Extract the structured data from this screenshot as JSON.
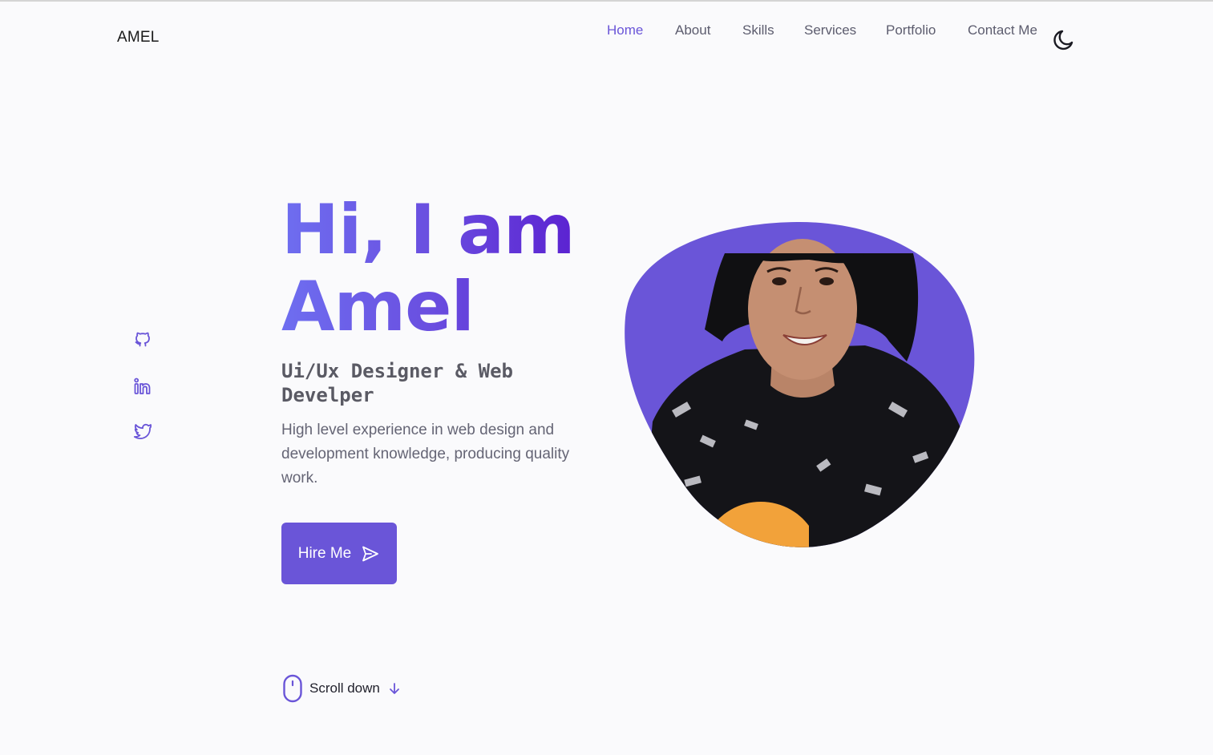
{
  "header": {
    "logo": "AMEL",
    "nav": [
      {
        "label": "Home",
        "active": true
      },
      {
        "label": "About",
        "active": false
      },
      {
        "label": "Skills",
        "active": false
      },
      {
        "label": "Services",
        "active": false
      },
      {
        "label": "Portfolio",
        "active": false
      },
      {
        "label": "Contact Me",
        "active": false
      }
    ],
    "theme_toggle_icon": "moon-icon"
  },
  "socials": [
    {
      "icon": "github-icon"
    },
    {
      "icon": "linkedin-icon"
    },
    {
      "icon": "twitter-icon"
    }
  ],
  "hero": {
    "title_line1": "Hi, I am",
    "title_line2": "Amel",
    "subtitle": "Ui/Ux Designer & Web Develper",
    "description": "High level experience in web design and development knowledge, producing quality work.",
    "cta_label": "Hire Me",
    "cta_icon": "send-icon",
    "scroll_label": "Scroll down",
    "scroll_icons": [
      "mouse-icon",
      "arrow-down-icon"
    ]
  },
  "profile_image": {
    "subject": "profile-photo",
    "blob_color": "#6a55d8"
  },
  "colors": {
    "accent": "#6a55d8",
    "gradient_start": "#6e6ef0",
    "gradient_end": "#5b22d1",
    "background": "#fafafc"
  }
}
